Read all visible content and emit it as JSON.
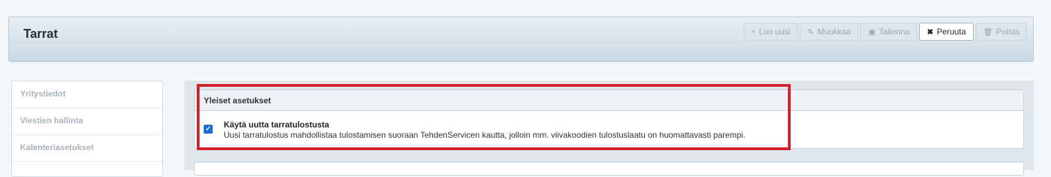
{
  "header": {
    "title": "Tarrat"
  },
  "toolbar": {
    "buttons": [
      {
        "icon": "plus-icon",
        "glyph": "+",
        "label": "Luo uusi"
      },
      {
        "icon": "pencil-icon",
        "glyph": "✎",
        "label": "Muokkaa"
      },
      {
        "icon": "save-icon",
        "glyph": "▣",
        "label": "Tallenna"
      },
      {
        "icon": "close-icon",
        "glyph": "✖",
        "label": "Peruuta"
      },
      {
        "icon": "trash-icon",
        "glyph": "🗑",
        "label": "Poista"
      }
    ]
  },
  "sidebar": {
    "items": [
      {
        "label": "Yritystiedot"
      },
      {
        "label": "Viestien hallinta"
      },
      {
        "label": "Kalenteriasetukset"
      }
    ]
  },
  "panel": {
    "header": "Yleiset asetukset",
    "option": {
      "checked": true,
      "title": "Käytä uutta tarratulostusta",
      "description": "Uusi tarratulostus mahdollistaa tulostamisen suoraan TehdenServicen kautta, jolloin mm. viivakoodien tulostuslaatu on huomattavasti parempi."
    }
  },
  "colors": {
    "highlight": "#d41e2a",
    "checkbox": "#1a6fd6"
  }
}
